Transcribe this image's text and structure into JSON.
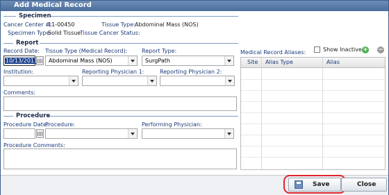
{
  "window": {
    "title": "Add Medical Record"
  },
  "specimen": {
    "section_label": "Specimen",
    "cancer_center_label": "Cancer Center #:",
    "cancer_center_value": "11-00450",
    "tissue_type_label": "Tissue Type:",
    "tissue_type_value": "Abdominal Mass (NOS)",
    "specimen_type_label": "Specimen Type:",
    "specimen_type_value": "Solid Tissue",
    "tissue_cancer_status_label": "Tissue Cancer Status:"
  },
  "report": {
    "section_label": "Report",
    "record_date_label": "Record Date:",
    "record_date_value": "10/13/2011",
    "tissue_type_label": "Tissue Type (Medical Record):",
    "tissue_type_value": "Abdominal Mass (NOS)",
    "report_type_label": "Report Type:",
    "report_type_value": "SurgPath",
    "institution_label": "Institution:",
    "reporting_physician1_label": "Reporting Physician 1:",
    "reporting_physician2_label": "Reporting Physician 2:",
    "comments_label": "Comments:"
  },
  "procedure": {
    "section_label": "Procedure",
    "procedure_date_label": "Procedure Date:",
    "procedure_label": "Procedure:",
    "performing_physician_label": "Performing Physician:",
    "procedure_comments_label": "Procedure Comments:"
  },
  "aliases": {
    "title": "Medical Record Aliases:",
    "show_inactive_label": "Show Inactive",
    "columns": [
      "Site",
      "Alias Type",
      "Alias"
    ]
  },
  "footer": {
    "save_label": "Save",
    "close_label": "Close"
  }
}
